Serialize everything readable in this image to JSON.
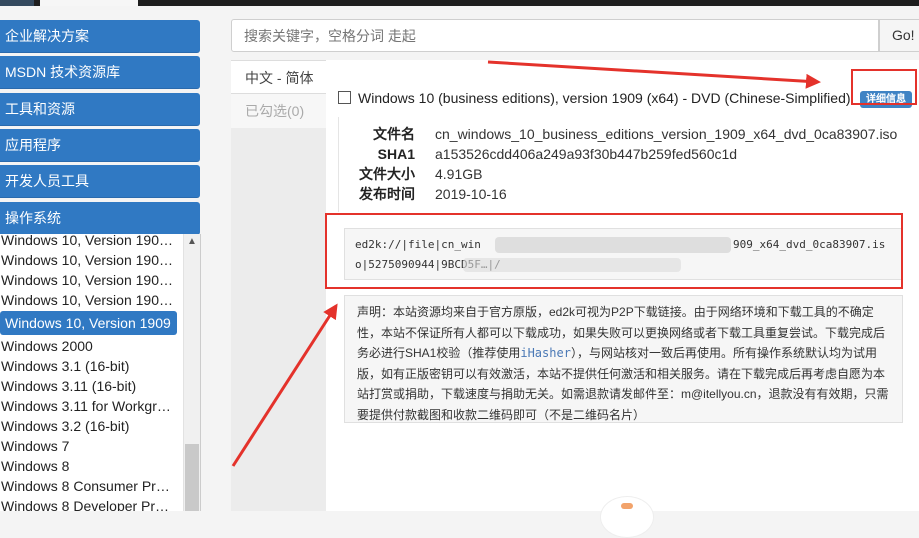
{
  "sidebar": {
    "menu": [
      {
        "label": "企业解决方案"
      },
      {
        "label": "MSDN 技术资源库"
      },
      {
        "label": "工具和资源"
      },
      {
        "label": "应用程序"
      },
      {
        "label": "开发人员工具"
      },
      {
        "label": "操作系统"
      }
    ],
    "os_items": [
      {
        "label": "Windows 10, Version 190…"
      },
      {
        "label": "Windows 10, Version 190…"
      },
      {
        "label": "Windows 10, Version 190…"
      },
      {
        "label": "Windows 10, Version 190…"
      },
      {
        "label": "Windows 10, Version 1909"
      },
      {
        "label": "Windows 2000"
      },
      {
        "label": "Windows 3.1 (16-bit)"
      },
      {
        "label": "Windows 3.11 (16-bit)"
      },
      {
        "label": "Windows 3.11 for Workgr…"
      },
      {
        "label": "Windows 3.2 (16-bit)"
      },
      {
        "label": "Windows 7"
      },
      {
        "label": "Windows 8"
      },
      {
        "label": "Windows 8 Consumer Pr…"
      },
      {
        "label": "Windows 8 Developer Pr…"
      }
    ],
    "scroll_up_icon": "▲"
  },
  "search": {
    "placeholder": "搜索关键字，空格分词 走起",
    "go_label": "Go!"
  },
  "tabs": [
    {
      "label": "中文 - 简体"
    },
    {
      "label": "已勾选(0)"
    }
  ],
  "item": {
    "title": "Windows 10 (business editions), version 1909 (x64) - DVD (Chinese-Simplified)",
    "detail_button": "详细信息",
    "fields": [
      {
        "label": "文件名",
        "value": "cn_windows_10_business_editions_version_1909_x64_dvd_0ca83907.iso"
      },
      {
        "label": "SHA1",
        "value": "a153526cdd406a249a93f30b447b259fed560c1d"
      },
      {
        "label": "文件大小",
        "value": "4.91GB"
      },
      {
        "label": "发布时间",
        "value": "2019-10-16"
      }
    ],
    "ed2k_line1_prefix": "ed2k://|file|cn_win",
    "ed2k_line1_suffix": "909_x64_dvd_0ca83907.is",
    "ed2k_line2": "o|5275090944|9BCD5F…|/"
  },
  "notice": {
    "text_before_link": "声明：本站资源均来自于官方原版，ed2k可视为P2P下载链接。由于网络环境和下载工具的不确定性，本站不保证所有人都可以下载成功，如果失败可以更换网络或者下载工具重复尝试。下载完成后务必进行SHA1校验（推荐使用",
    "link": "iHasher",
    "text_after_link": "），与网站核对一致后再使用。所有操作系统默认均为试用版，如有正版密钥可以有效激活，本站不提供任何激活和相关服务。请在下载完成后再考虑自愿为本站打赏或捐助，下载速度与捐助无关。如需退款请发邮件至：m@itellyou.cn，退款没有有效期，只需要提供付款截图和收款二维码即可（不是二维码名片）"
  },
  "colors": {
    "accent": "#3079c3",
    "annotation_red": "#e4322b"
  }
}
